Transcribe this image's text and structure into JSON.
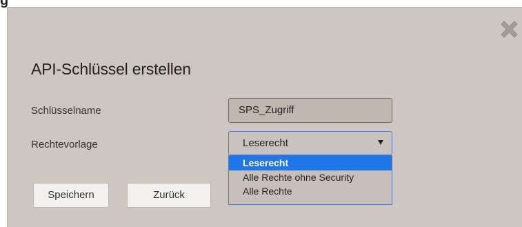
{
  "page": {
    "top_fragment": "g"
  },
  "dialog": {
    "title": "API-Schlüssel erstellen",
    "close_icon": "close-x-icon",
    "fields": {
      "key_name": {
        "label": "Schlüsselname",
        "value": "SPS_Zugriff"
      },
      "rights_template": {
        "label": "Rechtevorlage",
        "selected": "Leserecht",
        "options": [
          "Leserecht",
          "Alle Rechte ohne Security",
          "Alle Rechte"
        ],
        "highlighted_index": 0
      }
    },
    "buttons": {
      "save": "Speichern",
      "back": "Zurück"
    }
  },
  "colors": {
    "dialog_bg": "#cdc6c1",
    "highlight": "#1e76e8",
    "focus_border": "#5a78b6"
  }
}
